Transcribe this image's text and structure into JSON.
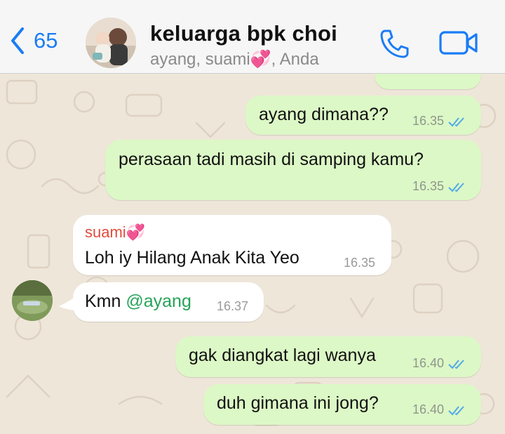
{
  "header": {
    "back_count": "65",
    "title": "keluarga bpk choi",
    "subtitle": "ayang, suami💞, Anda"
  },
  "messages": [
    {
      "text": "ayang dimana??",
      "time": "16.35",
      "direction": "outgoing",
      "status": "read"
    },
    {
      "text": "perasaan tadi masih di samping kamu?",
      "time": "16.35",
      "direction": "outgoing",
      "status": "read"
    },
    {
      "sender": "suami💞",
      "text": "Loh iy Hilang Anak Kita Yeo",
      "time": "16.35",
      "direction": "incoming"
    },
    {
      "text_prefix": "Kmn ",
      "mention": "@ayang",
      "time": "16.37",
      "direction": "incoming"
    },
    {
      "text": "gak diangkat lagi wanya",
      "time": "16.40",
      "direction": "outgoing",
      "status": "read"
    },
    {
      "text": "duh gimana ini jong?",
      "time": "16.40",
      "direction": "outgoing",
      "status": "read"
    }
  ],
  "colors": {
    "accent": "#1a7cf5",
    "outgoing_bubble": "#dcf8c6",
    "incoming_bubble": "#ffffff",
    "read_ticks": "#4fa9e8",
    "sender_name": "#e14c3c",
    "mention": "#27a35a",
    "wallpaper": "#efe6da"
  },
  "icons": [
    "back-chevron-icon",
    "phone-icon",
    "video-camera-icon",
    "double-check-icon"
  ]
}
